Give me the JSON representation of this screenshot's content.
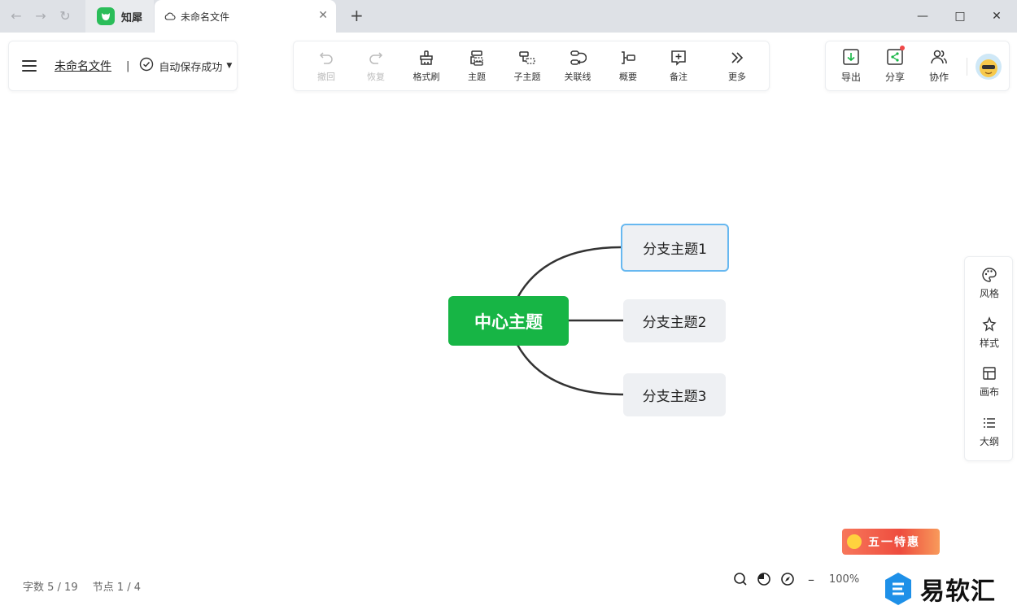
{
  "browser": {
    "app_tab_label": "知犀",
    "doc_tab_title": "未命名文件"
  },
  "header": {
    "file_name": "未命名文件",
    "separator": "|",
    "save_status": "自动保存成功"
  },
  "toolbar": {
    "undo": "撤回",
    "redo": "恢复",
    "format_brush": "格式刷",
    "topic": "主题",
    "subtopic": "子主题",
    "relation_line": "关联线",
    "summary": "概要",
    "note": "备注",
    "more": "更多"
  },
  "actions": {
    "export": "导出",
    "share": "分享",
    "collaborate": "协作"
  },
  "side_panel": {
    "style_theme": "风格",
    "style": "样式",
    "canvas": "画布",
    "outline": "大纲"
  },
  "mindmap": {
    "center": "中心主题",
    "branches": [
      "分支主题1",
      "分支主题2",
      "分支主题3"
    ],
    "selected_branch": 0
  },
  "status": {
    "word_count": "字数 5 / 19",
    "node_count": "节点 1 / 4",
    "zoom": "100%"
  },
  "promo": "五一特惠",
  "watermark": "易软汇",
  "colors": {
    "center_fill": "#17b545",
    "branch_fill": "#eef0f3",
    "selection": "#67b8f0",
    "line": "#333333"
  }
}
